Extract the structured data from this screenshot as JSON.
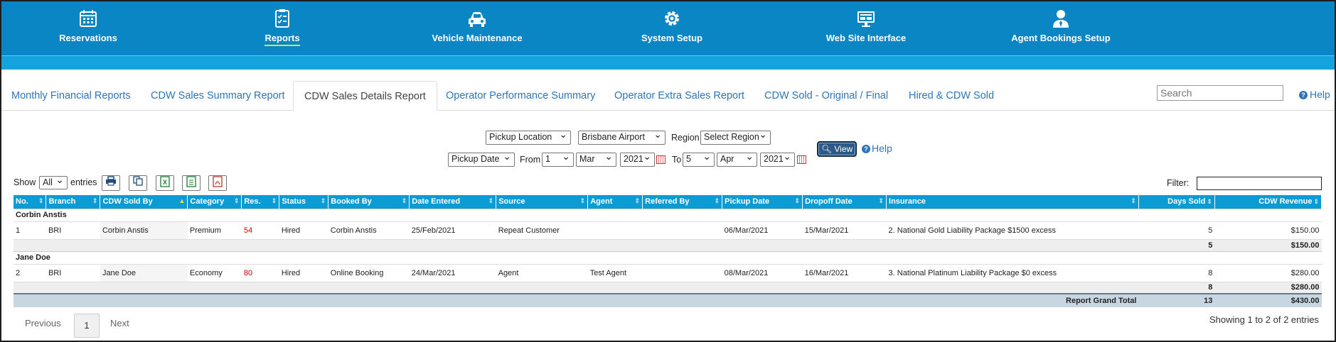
{
  "nav": {
    "items": [
      {
        "label": "Reservations",
        "icon": "calendar-icon"
      },
      {
        "label": "Reports",
        "icon": "clipboard-list-icon",
        "active": true
      },
      {
        "label": "Vehicle Maintenance",
        "icon": "car-icon"
      },
      {
        "label": "System Setup",
        "icon": "gear-icon"
      },
      {
        "label": "Web Site Interface",
        "icon": "monitor-icon"
      },
      {
        "label": "Agent Bookings Setup",
        "icon": "agent-user-icon"
      }
    ],
    "accent": "#0b86c4"
  },
  "tabs": [
    {
      "label": "Monthly Financial Reports"
    },
    {
      "label": "CDW Sales Summary Report"
    },
    {
      "label": "CDW Sales Details Report",
      "active": true
    },
    {
      "label": "Operator Performance Summary"
    },
    {
      "label": "Operator Extra Sales Report"
    },
    {
      "label": "CDW Sold - Original / Final"
    },
    {
      "label": "Hired & CDW Sold"
    }
  ],
  "search": {
    "placeholder": "Search"
  },
  "help_label": "Help",
  "filters": {
    "location_type": "Pickup Location",
    "location": "Brisbane Airport",
    "region_label": "Region",
    "region": "Select Region",
    "date_type": "Pickup Date",
    "from_label": "From",
    "from_day": "1",
    "from_month": "Mar",
    "from_year": "2021",
    "to_label": "To",
    "to_day": "5",
    "to_month": "Apr",
    "to_year": "2021",
    "view_label": "View",
    "help_label": "Help"
  },
  "entries": {
    "show_label": "Show",
    "value": "All",
    "entries_label": "entries",
    "filter_label": "Filter:"
  },
  "table": {
    "headers": [
      "No.",
      "Branch",
      "CDW Sold By",
      "Category",
      "Res.",
      "Status",
      "Booked By",
      "Date Entered",
      "Source",
      "Agent",
      "Referred By",
      "Pickup Date",
      "Dropoff Date",
      "Insurance",
      "Days Sold",
      "CDW Revenue"
    ],
    "groups": [
      {
        "name": "Corbin Anstis",
        "rows": [
          {
            "no": "1",
            "branch": "BRI",
            "sold_by": "Corbin Anstis",
            "category": "Premium",
            "res": "54",
            "status": "Hired",
            "booked_by": "Corbin Anstis",
            "date_entered": "25/Feb/2021",
            "source": "Repeat Customer",
            "agent": "",
            "referred_by": "",
            "pickup": "06/Mar/2021",
            "dropoff": "15/Mar/2021",
            "insurance": "2. National Gold Liability Package $1500 excess",
            "days": "5",
            "revenue": "$150.00"
          }
        ],
        "subtotal_days": "5",
        "subtotal_revenue": "$150.00"
      },
      {
        "name": "Jane Doe",
        "rows": [
          {
            "no": "2",
            "branch": "BRI",
            "sold_by": "Jane Doe",
            "category": "Economy",
            "res": "80",
            "status": "Hired",
            "booked_by": "Online Booking",
            "date_entered": "24/Mar/2021",
            "source": "Agent",
            "agent": "Test Agent",
            "referred_by": "",
            "pickup": "08/Mar/2021",
            "dropoff": "16/Mar/2021",
            "insurance": "3. National Platinum Liability Package $0 excess",
            "days": "8",
            "revenue": "$280.00"
          }
        ],
        "subtotal_days": "8",
        "subtotal_revenue": "$280.00"
      }
    ],
    "grand_total_label": "Report Grand Total",
    "grand_total_days": "13",
    "grand_total_revenue": "$430.00"
  },
  "pagination": {
    "previous": "Previous",
    "current": "1",
    "next": "Next",
    "summary": "Showing 1 to 2 of 2 entries"
  }
}
